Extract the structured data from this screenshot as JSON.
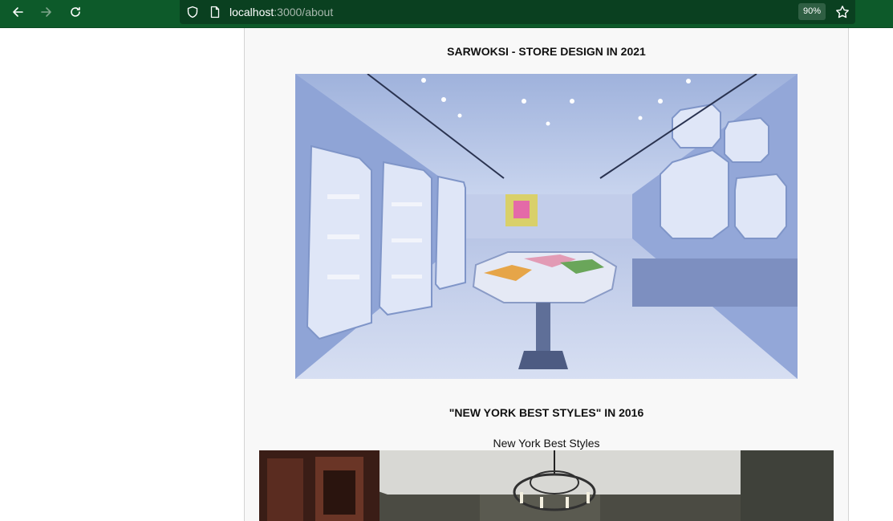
{
  "browser": {
    "url_host": "localhost",
    "url_path": ":3000/about",
    "zoom": "90%",
    "icons": [
      "back-arrow-icon",
      "forward-arrow-icon",
      "reload-icon",
      "shield-icon",
      "page-icon",
      "star-icon"
    ]
  },
  "page": {
    "sections": [
      {
        "title": "SARWOKSI - STORE DESIGN IN 2021"
      },
      {
        "title": "\"NEW YORK BEST STYLES\" IN 2016",
        "caption": "New York Best Styles"
      }
    ]
  },
  "colors": {
    "toolbar": "#0d5a2a",
    "urlbar": "#0a4020",
    "panel": "#f8f8f8"
  }
}
